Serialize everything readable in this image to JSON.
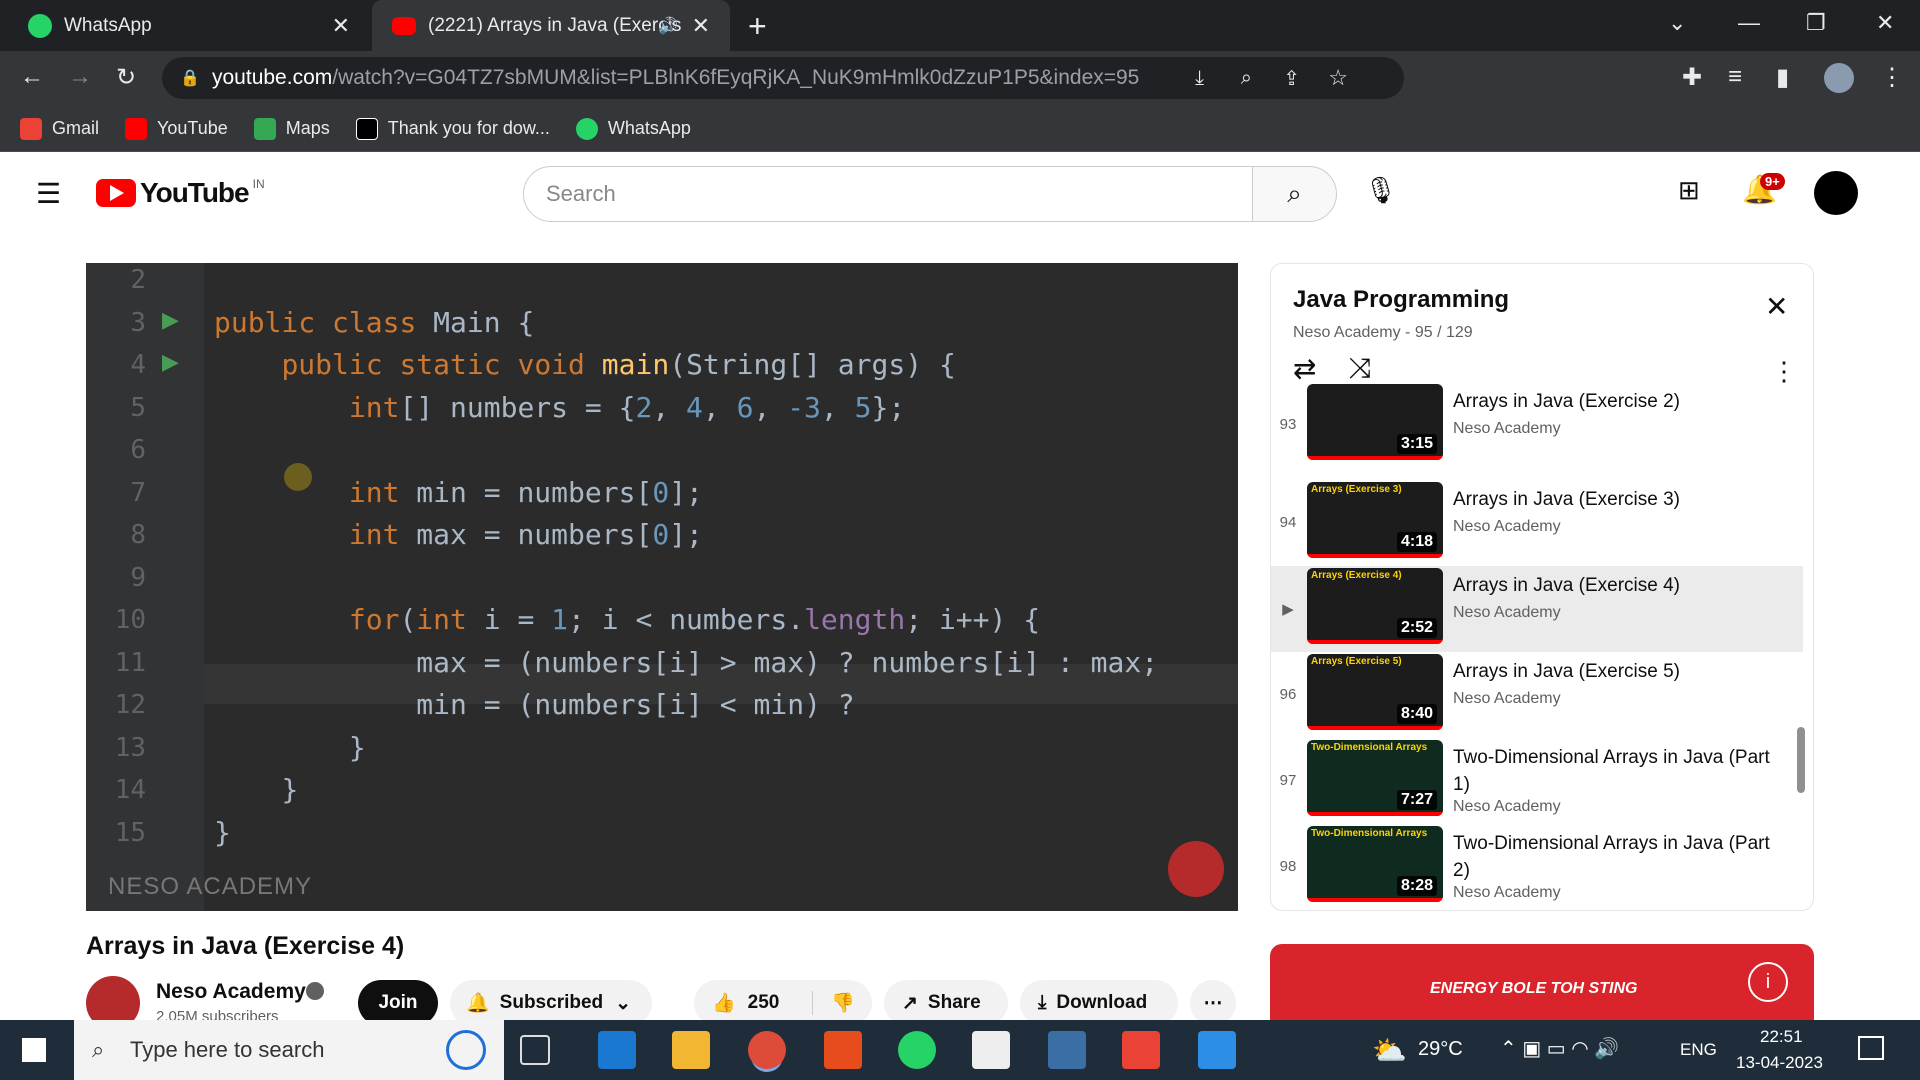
{
  "browser": {
    "tabs": [
      {
        "title": "WhatsApp",
        "icon": "whatsapp-icon"
      },
      {
        "title": "(2221) Arrays in Java (Exercis",
        "icon": "youtube-icon"
      }
    ],
    "url_host": "youtube.com",
    "url_path": "/watch?v=G04TZ7sbMUM&list=PLBlnK6fEyqRjKA_NuK9mHmlk0dZzuP1P5&index=95",
    "bookmarks": [
      "Gmail",
      "YouTube",
      "Maps",
      "Thank you for dow...",
      "WhatsApp"
    ]
  },
  "youtube": {
    "logo_text": "YouTube",
    "region": "IN",
    "search_placeholder": "Search",
    "notification_count": "9+"
  },
  "player": {
    "line_numbers": [
      "2",
      "3",
      "4",
      "5",
      "6",
      "7",
      "8",
      "9",
      "10",
      "11",
      "12",
      "13",
      "14",
      "15"
    ],
    "code_lines": [
      "",
      "public class Main {",
      "    public static void main(String[] args) {",
      "        int[] numbers = {2, 4, 6, -3, 5};",
      "",
      "        int min = numbers[0];",
      "        int max = numbers[0];",
      "",
      "        for(int i = 1; i < numbers.length; i++) {",
      "            max = (numbers[i] > max) ? numbers[i] : max;",
      "            min = (numbers[i] < min) ?",
      "        }",
      "    }",
      "}"
    ],
    "watermark": "NESO ACADEMY"
  },
  "playlist": {
    "title": "Java Programming",
    "subtitle": "Neso Academy - 95 / 129",
    "items": [
      {
        "index": "93",
        "title": "Arrays in Java (Exercise 2)",
        "channel": "Neso Academy",
        "duration": "3:15",
        "thumb_label": ""
      },
      {
        "index": "94",
        "title": "Arrays in Java (Exercise 3)",
        "channel": "Neso Academy",
        "duration": "4:18",
        "thumb_label": "Arrays (Exercise 3)"
      },
      {
        "index": "",
        "title": "Arrays in Java (Exercise 4)",
        "channel": "Neso Academy",
        "duration": "2:52",
        "thumb_label": "Arrays (Exercise 4)"
      },
      {
        "index": "96",
        "title": "Arrays in Java (Exercise 5)",
        "channel": "Neso Academy",
        "duration": "8:40",
        "thumb_label": "Arrays (Exercise 5)"
      },
      {
        "index": "97",
        "title": "Two-Dimensional Arrays in Java (Part 1)",
        "channel": "Neso Academy",
        "duration": "7:27",
        "thumb_label": "Two-Dimensional Arrays"
      },
      {
        "index": "98",
        "title": "Two-Dimensional Arrays in Java (Part 2)",
        "channel": "Neso Academy",
        "duration": "8:28",
        "thumb_label": "Two-Dimensional Arrays"
      }
    ]
  },
  "video": {
    "title": "Arrays in Java (Exercise 4)",
    "channel": "Neso Academy",
    "subscribers": "2.05M subscribers",
    "join_label": "Join",
    "subscribed_label": "Subscribed",
    "likes": "250",
    "share_label": "Share",
    "download_label": "Download"
  },
  "ad": {
    "text": "ENERGY BOLE TOH STING"
  },
  "taskbar": {
    "search_placeholder": "Type here to search",
    "weather": "29°C",
    "lang": "ENG",
    "time": "22:51",
    "date": "13-04-2023"
  }
}
